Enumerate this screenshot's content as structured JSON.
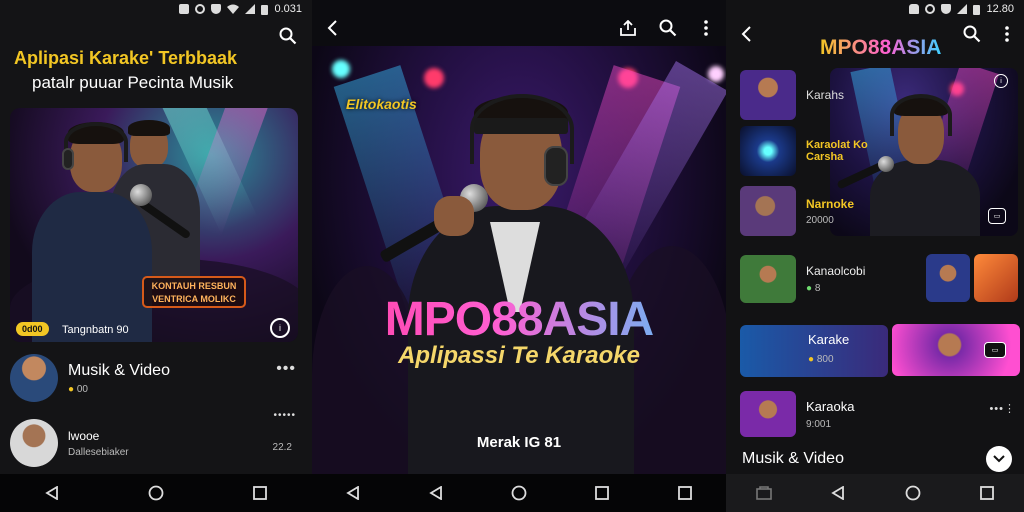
{
  "left": {
    "status": {
      "time": "0.031"
    },
    "heading_line1": "Aplipasi Karake' Terbbaak",
    "heading_line2": "patalr puuar Pecinta Musik",
    "hero_overlay_line1": "KONTAUH RESBUN",
    "hero_overlay_line2": "VENTRICA MOLIKC",
    "hero_badge": "0d00",
    "hero_caption": "Tangnbatn 90",
    "list": [
      {
        "title": "Musik & Video",
        "meta": "00"
      },
      {
        "title": "lwooe",
        "meta": "Dallesebiaker",
        "side": "22.2"
      }
    ]
  },
  "middle": {
    "tag": "Elitokaotis",
    "brand": "MPO88ASIA",
    "subtitle": "Aplipassi Te Karaoke",
    "footer": "Merak IG 81"
  },
  "right": {
    "status": {
      "time": "12.80"
    },
    "brand": "MPO88ASIA",
    "items": [
      {
        "label": "Karahs"
      },
      {
        "label": "Karaolat Ko\nCarsha"
      },
      {
        "label": "Narnoke",
        "meta": "20000"
      },
      {
        "label": "Kanaolcobi",
        "meta": "8"
      },
      {
        "label": "Karake",
        "meta": "800"
      },
      {
        "label": "Karaoka",
        "meta": "9:001"
      }
    ],
    "section_title": "Musik & Video"
  },
  "colors": {
    "accent_yellow": "#f2c624",
    "brand_pink": "#ff3fa4",
    "brand_cyan": "#3fd0ff",
    "stage_purple": "#6a1b9a",
    "stage_blue": "#0d47a1"
  },
  "icons": [
    "search-icon",
    "back-icon",
    "more-vert-icon",
    "share-icon",
    "nav-back-icon",
    "nav-home-icon",
    "nav-recents-icon",
    "wifi-icon",
    "signal-icon",
    "battery-icon"
  ]
}
